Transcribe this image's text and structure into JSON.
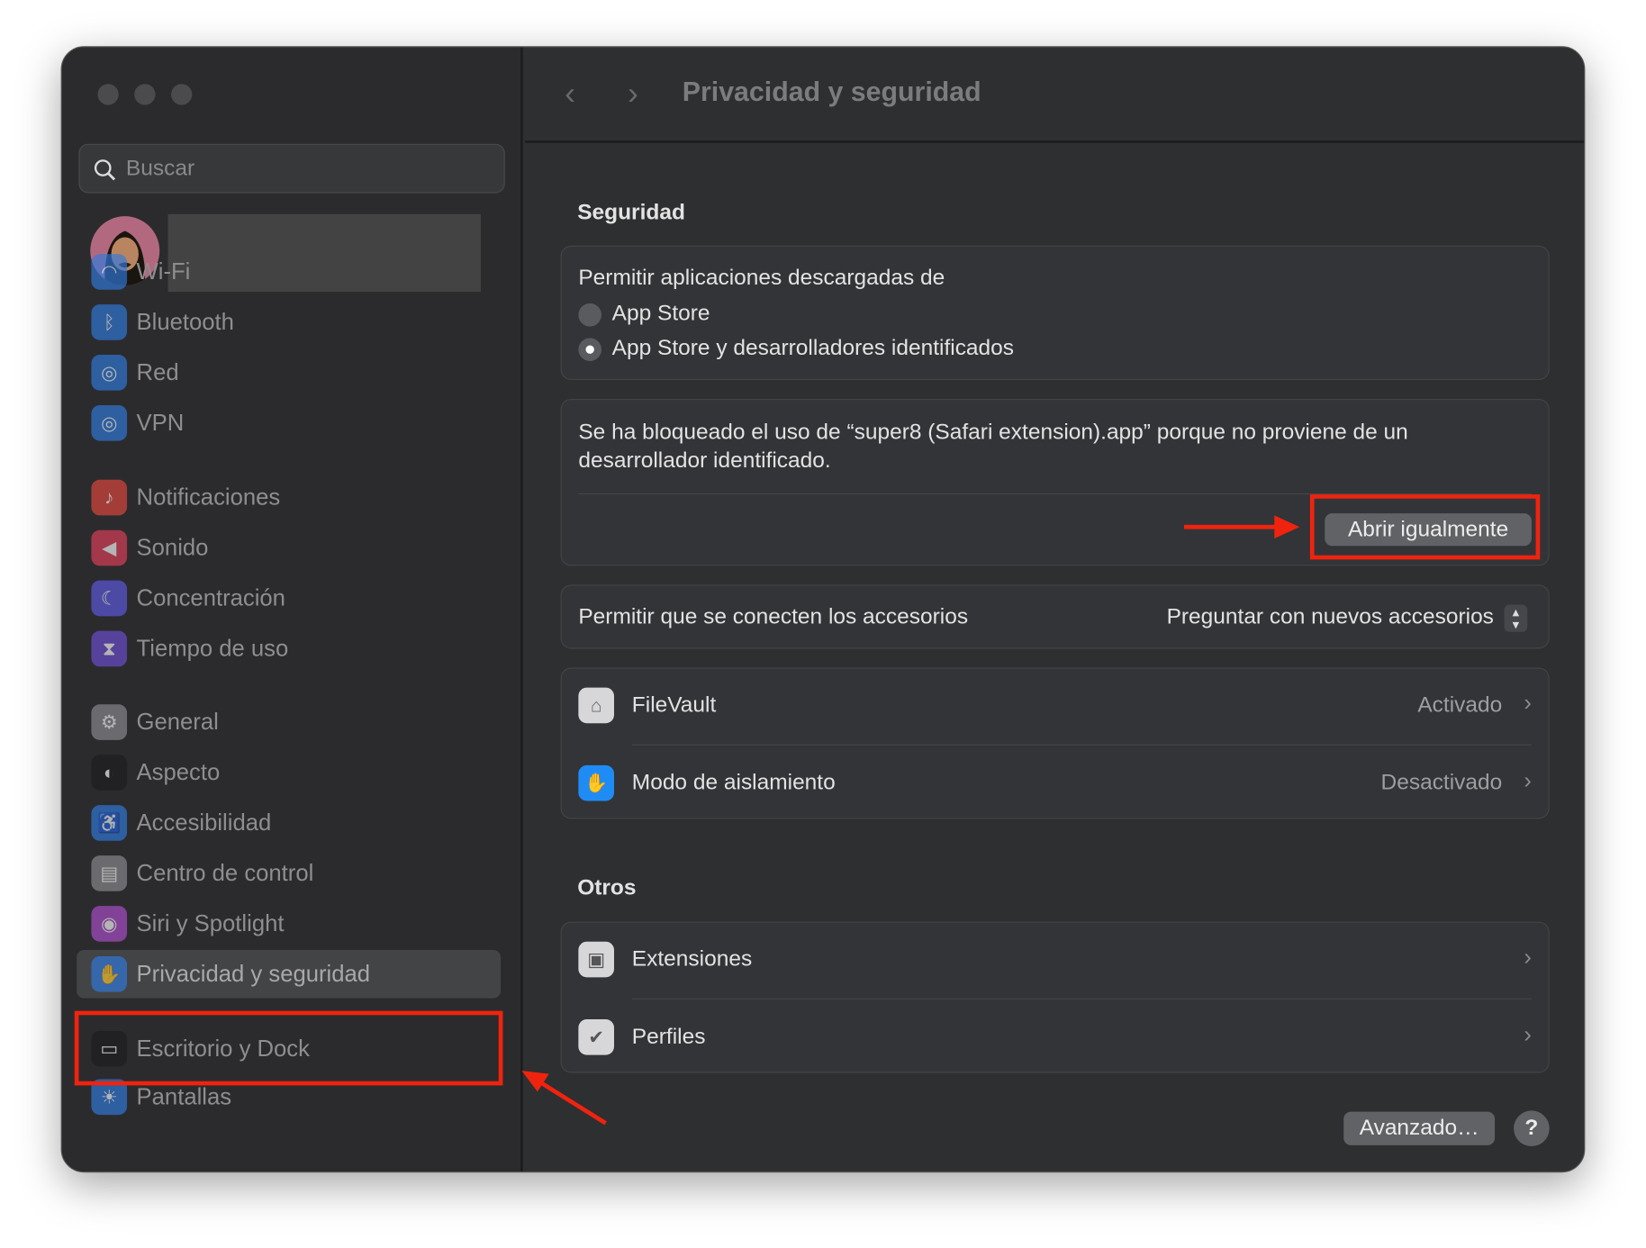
{
  "window": {
    "title": "Privacidad y seguridad"
  },
  "sidebar": {
    "search_placeholder": "Buscar",
    "items": [
      {
        "label": "Wi-Fi",
        "icon": "wifi-icon",
        "color": "#2f7be0"
      },
      {
        "label": "Bluetooth",
        "icon": "bluetooth-icon",
        "color": "#2f7be0"
      },
      {
        "label": "Red",
        "icon": "globe-icon",
        "color": "#2f7be0"
      },
      {
        "label": "VPN",
        "icon": "vpn-globe-icon",
        "color": "#2f7be0"
      },
      {
        "label": "Notificaciones",
        "icon": "bell-icon",
        "color": "#e5473f"
      },
      {
        "label": "Sonido",
        "icon": "speaker-icon",
        "color": "#e2405a"
      },
      {
        "label": "Concentración",
        "icon": "moon-icon",
        "color": "#5e5ce6"
      },
      {
        "label": "Tiempo de uso",
        "icon": "hourglass-icon",
        "color": "#6e4fd6"
      },
      {
        "label": "General",
        "icon": "gear-icon",
        "color": "#8e8e93"
      },
      {
        "label": "Aspecto",
        "icon": "appearance-icon",
        "color": "#1c1c1e"
      },
      {
        "label": "Accesibilidad",
        "icon": "accessibility-icon",
        "color": "#2f7be0"
      },
      {
        "label": "Centro de control",
        "icon": "control-center-icon",
        "color": "#8e8e93"
      },
      {
        "label": "Siri y Spotlight",
        "icon": "siri-icon",
        "color": "#b04fd0"
      },
      {
        "label": "Privacidad y seguridad",
        "icon": "hand-icon",
        "color": "#2f7be0",
        "selected": true
      },
      {
        "label": "Escritorio y Dock",
        "icon": "dock-icon",
        "color": "#1c1c1e"
      },
      {
        "label": "Pantallas",
        "icon": "sun-icon",
        "color": "#2f7be0"
      }
    ]
  },
  "security": {
    "heading": "Seguridad",
    "allow_label": "Permitir aplicaciones descargadas de",
    "options": [
      {
        "label": "App Store",
        "selected": false
      },
      {
        "label": "App Store y desarrolladores identificados",
        "selected": true
      }
    ],
    "blocked_line1": "Se ha bloqueado el uso de “super8 (Safari extension).app” porque no proviene de un",
    "blocked_line2": "desarrollador identificado.",
    "open_anyway": "Abrir igualmente",
    "accessories_label": "Permitir que se conecten los accesorios",
    "accessories_value": "Preguntar con nuevos accesorios",
    "filevault": {
      "label": "FileVault",
      "value": "Activado"
    },
    "lockdown": {
      "label": "Modo de aislamiento",
      "value": "Desactivado"
    }
  },
  "others": {
    "heading": "Otros",
    "items": [
      {
        "label": "Extensiones"
      },
      {
        "label": "Perfiles"
      }
    ]
  },
  "footer": {
    "advanced": "Avanzado…",
    "help": "?"
  },
  "annotation_color": "#f0230e"
}
